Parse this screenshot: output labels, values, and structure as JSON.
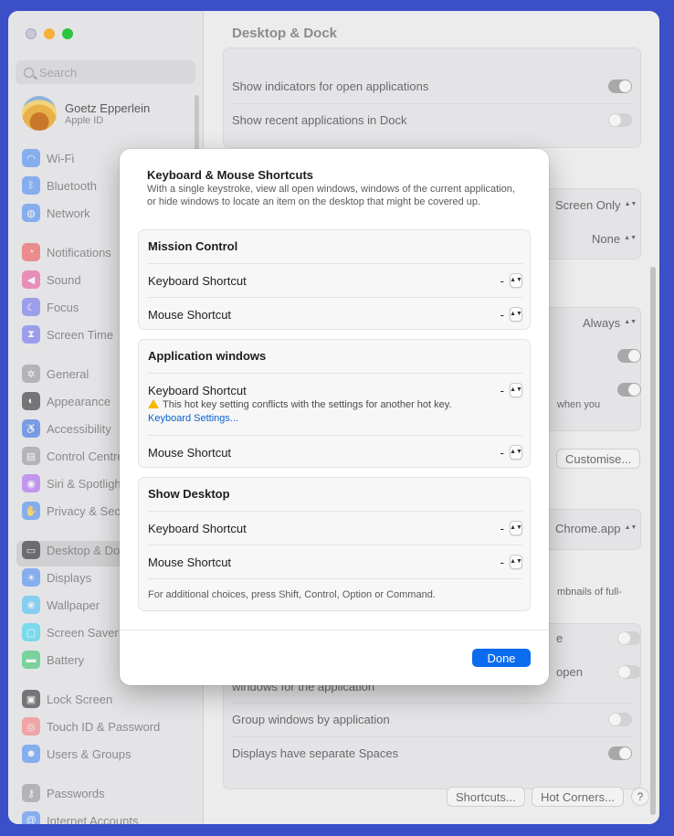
{
  "window": {
    "title": "Desktop & Dock"
  },
  "sidebar": {
    "search_placeholder": "Search",
    "profile": {
      "name": "Goetz Epperlein",
      "subtitle": "Apple ID"
    },
    "items": [
      {
        "label": "Wi-Fi",
        "icon": "wifi-icon",
        "color": "#3b82f6"
      },
      {
        "label": "Bluetooth",
        "icon": "bluetooth-icon",
        "color": "#3b82f6"
      },
      {
        "label": "Network",
        "icon": "globe-icon",
        "color": "#3b82f6"
      },
      {
        "label": "Notifications",
        "icon": "bell-icon",
        "color": "#ef4444"
      },
      {
        "label": "Sound",
        "icon": "speaker-icon",
        "color": "#ec4899"
      },
      {
        "label": "Focus",
        "icon": "moon-icon",
        "color": "#6366f1"
      },
      {
        "label": "Screen Time",
        "icon": "hourglass-icon",
        "color": "#6366f1"
      },
      {
        "label": "General",
        "icon": "gear-icon",
        "color": "#8e8e93"
      },
      {
        "label": "Appearance",
        "icon": "appearance-icon",
        "color": "#1c1c1e"
      },
      {
        "label": "Accessibility",
        "icon": "accessibility-icon",
        "color": "#2563eb"
      },
      {
        "label": "Control Centre",
        "icon": "control-centre-icon",
        "color": "#8e8e93"
      },
      {
        "label": "Siri & Spotlight",
        "icon": "siri-icon",
        "color": "#a855f7"
      },
      {
        "label": "Privacy & Security",
        "icon": "hand-icon",
        "color": "#3b82f6"
      },
      {
        "label": "Desktop & Dock",
        "icon": "dock-icon",
        "color": "#1c1c1e"
      },
      {
        "label": "Displays",
        "icon": "sun-icon",
        "color": "#3b82f6"
      },
      {
        "label": "Wallpaper",
        "icon": "flower-icon",
        "color": "#38bdf8"
      },
      {
        "label": "Screen Saver",
        "icon": "screensaver-icon",
        "color": "#22d3ee"
      },
      {
        "label": "Battery",
        "icon": "battery-icon",
        "color": "#22c55e"
      },
      {
        "label": "Lock Screen",
        "icon": "lock-icon",
        "color": "#1c1c1e"
      },
      {
        "label": "Touch ID & Password",
        "icon": "fingerprint-icon",
        "color": "#f87171"
      },
      {
        "label": "Users & Groups",
        "icon": "users-icon",
        "color": "#3b82f6"
      },
      {
        "label": "Passwords",
        "icon": "key-icon",
        "color": "#8e8e93"
      },
      {
        "label": "Internet Accounts",
        "icon": "at-icon",
        "color": "#3b82f6"
      }
    ]
  },
  "main": {
    "rows": [
      {
        "label": "Show indicators for open applications",
        "on": true
      },
      {
        "label": "Show recent applications in Dock",
        "on": false
      },
      {
        "label": "Group windows by application",
        "on": false
      },
      {
        "label": "Displays have separate Spaces",
        "on": true
      }
    ],
    "popups": {
      "screen_only": "Screen Only",
      "none": "None",
      "always": "Always",
      "chrome": "Chrome.app"
    },
    "fragments": {
      "when_you": "when you",
      "thumbnails": "mbnails of full-",
      "e_suffix": "e",
      "open_suffix": "open",
      "windows_for_app": "windows for the application"
    },
    "customise_button": "Customise...",
    "shortcuts_button": "Shortcuts...",
    "hot_corners_button": "Hot Corners...",
    "help_button": "?"
  },
  "dialog": {
    "title": "Keyboard & Mouse Shortcuts",
    "description": "With a single keystroke, view all open windows, windows of the current application, or hide windows to locate an item on the desktop that might be covered up.",
    "groups": {
      "mission_control": {
        "heading": "Mission Control",
        "keyboard_label": "Keyboard Shortcut",
        "keyboard_value": "-",
        "mouse_label": "Mouse Shortcut",
        "mouse_value": "-"
      },
      "app_windows": {
        "heading": "Application windows",
        "keyboard_label": "Keyboard Shortcut",
        "keyboard_value": "-",
        "warning_text": "This hot key setting conflicts with the settings for another hot key.",
        "warning_link": "Keyboard Settings...",
        "mouse_label": "Mouse Shortcut",
        "mouse_value": "-"
      },
      "show_desktop": {
        "heading": "Show Desktop",
        "keyboard_label": "Keyboard Shortcut",
        "keyboard_value": "-",
        "mouse_label": "Mouse Shortcut",
        "mouse_value": "-",
        "footnote": "For additional choices, press Shift, Control, Option or Command."
      }
    },
    "done_button": "Done"
  }
}
